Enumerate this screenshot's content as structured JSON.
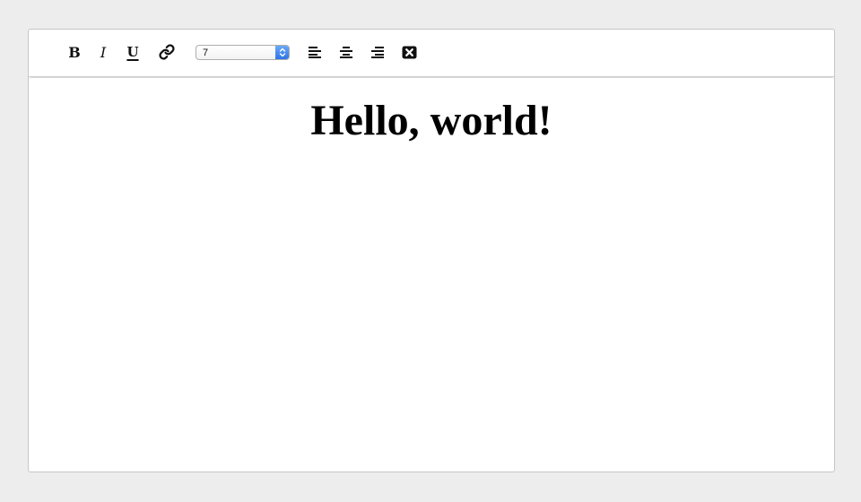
{
  "toolbar": {
    "bold_label": "B",
    "italic_label": "I",
    "underline_label": "U",
    "link_icon": "link-icon",
    "font_size": {
      "selected": "7"
    },
    "align_left_icon": "align-left-icon",
    "align_center_icon": "align-center-icon",
    "align_right_icon": "align-right-icon",
    "clear_format_icon": "clear-format-icon"
  },
  "editor": {
    "content": "Hello, world!"
  },
  "colors": {
    "page_background": "#ededed",
    "editor_background": "#ffffff",
    "border": "#c6c6c6",
    "select_accent": "#3b7ded"
  }
}
